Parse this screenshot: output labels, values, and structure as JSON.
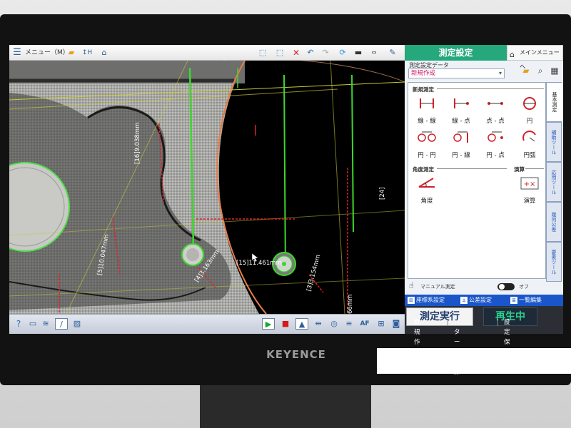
{
  "toolbar": {
    "menu_label": "メニュー（M）"
  },
  "view": {
    "measurements": [
      {
        "id": "[15]",
        "value": "11.461mm"
      },
      {
        "id": "[16]",
        "value": "9.038mm"
      },
      {
        "id": "[5]",
        "value": "10.047mm"
      },
      {
        "id": "[4]",
        "value": "3.163mm"
      },
      {
        "id": "[3]",
        "value": "3.154mm"
      },
      {
        "id": "[24]",
        "value": ""
      },
      {
        "id": "",
        "value": "66mm"
      }
    ]
  },
  "panel": {
    "title": "測定設定",
    "main_menu": "メインメニューへ",
    "settings_label": "測定設定データ",
    "settings_value": "新規作成",
    "section_new": "新規測定",
    "section_angle": "角度測定",
    "section_calc": "演算",
    "tools": [
      {
        "label": "線 - 線"
      },
      {
        "label": "線 - 点"
      },
      {
        "label": "点 - 点"
      },
      {
        "label": "円"
      },
      {
        "label": "円 - 円"
      },
      {
        "label": "円 - 線"
      },
      {
        "label": "円 - 点"
      },
      {
        "label": "円弧"
      },
      {
        "label": "角度"
      },
      {
        "label": "演算"
      }
    ],
    "tabs": [
      "基本測定",
      "補助ツール",
      "応用ツール",
      "幾何公差",
      "要素ツール"
    ],
    "manual_label": "マニュアル測定",
    "toggle_label": "オフ",
    "sub_buttons": [
      "座標系設定",
      "公差設定",
      "一覧編集"
    ],
    "run_label": "測定実行",
    "play_label": "再生中",
    "footer": [
      "新規作成",
      "パターン登録",
      "設定保存"
    ]
  },
  "brand": "KEYENCE",
  "colors": {
    "accent": "#24a87c",
    "measure_green": "#38d02a",
    "measure_red": "#e0202a",
    "tab_blue": "#1a56c9"
  }
}
